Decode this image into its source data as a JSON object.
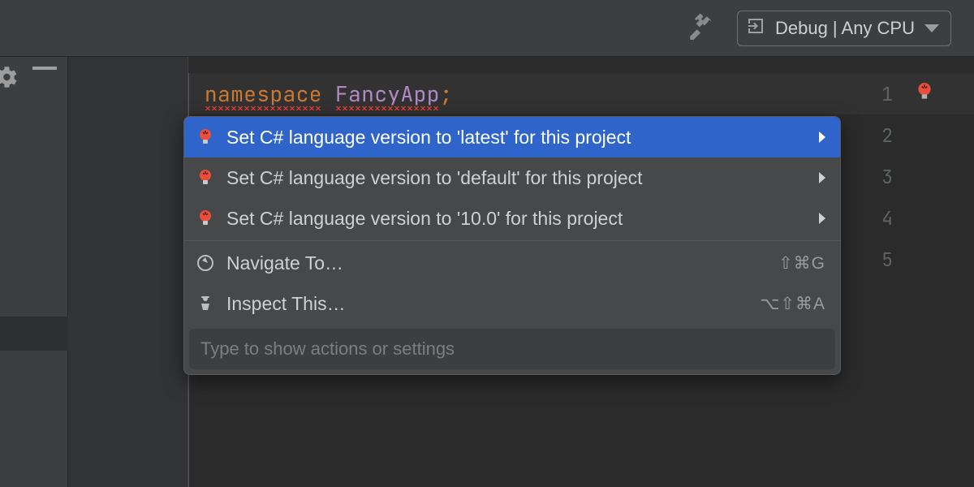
{
  "toolbar": {
    "build_config_label": "Debug | Any CPU"
  },
  "gutter": {
    "lines": [
      "1",
      "2",
      "3",
      "4",
      "5"
    ]
  },
  "code": {
    "keyword_namespace": "namespace",
    "typename": "FancyApp",
    "semicolon": ";"
  },
  "popup": {
    "items": [
      {
        "icon": "bulb-icon",
        "label": "Set C# language version to 'latest' for this project",
        "has_submenu": true,
        "shortcut": ""
      },
      {
        "icon": "bulb-icon",
        "label": "Set C# language version to 'default' for this project",
        "has_submenu": true,
        "shortcut": ""
      },
      {
        "icon": "bulb-icon",
        "label": "Set C# language version to '10.0' for this project",
        "has_submenu": true,
        "shortcut": ""
      },
      {
        "icon": "compass-icon",
        "label": "Navigate To…",
        "has_submenu": false,
        "shortcut": "⇧⌘G"
      },
      {
        "icon": "inspector-icon",
        "label": "Inspect This…",
        "has_submenu": false,
        "shortcut": "⌥⇧⌘A"
      }
    ],
    "search_placeholder": "Type to show actions or settings"
  }
}
